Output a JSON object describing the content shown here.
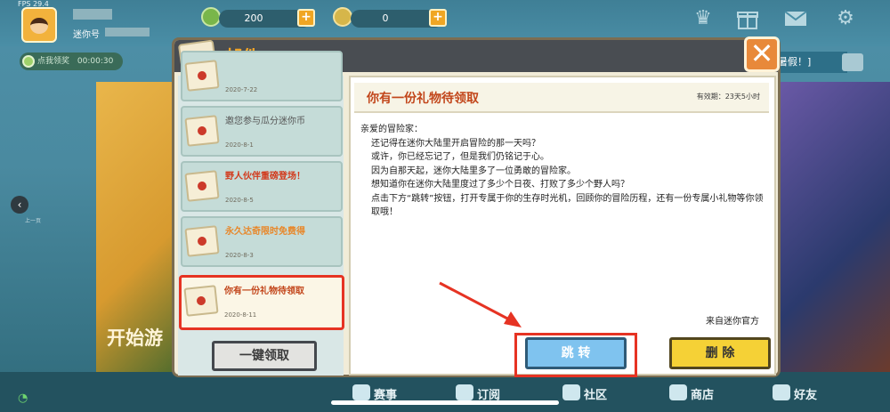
{
  "status": {
    "fps": "FPS 29.4"
  },
  "player": {
    "name": "迷你号"
  },
  "currencies": [
    {
      "icon": "mini-bean-icon",
      "value": "200"
    },
    {
      "icon": "mini-coin-icon",
      "value": "0"
    }
  ],
  "top_bar": {
    "icons": [
      "crown-icon",
      "gift-icon",
      "mail-icon",
      "gear-icon"
    ]
  },
  "claim_timer": {
    "label": "点我领奖",
    "time": "00:00:30"
  },
  "scene": {
    "prev_label": "上一页",
    "start_text": "开始游",
    "banner_text": "暑假！]"
  },
  "bottom_nav": [
    {
      "label": "赛事",
      "icon": "trophy-icon"
    },
    {
      "label": "订阅",
      "icon": "subscribe-icon"
    },
    {
      "label": "社区",
      "icon": "community-icon"
    },
    {
      "label": "商店",
      "icon": "cart-icon"
    },
    {
      "label": "好友",
      "icon": "friends-icon"
    }
  ],
  "mail_dialog": {
    "title": "邮件",
    "close_symbol": "✕",
    "items": [
      {
        "subject": "",
        "date": "2020-7-22",
        "color": "#3b3b3b"
      },
      {
        "subject": "邀您参与瓜分迷你币",
        "date": "2020-8-1",
        "color": "#555555"
      },
      {
        "subject": "野人伙伴重磅登场！",
        "date": "2020-8-5",
        "color": "#d23a1c"
      },
      {
        "subject": "永久达奇限时免费得",
        "date": "2020-8-3",
        "color": "#e8872a"
      },
      {
        "subject": "你有一份礼物待领取",
        "date": "2020-8-11",
        "color": "#c2461b",
        "selected": true
      }
    ],
    "claim_all_label": "一键领取",
    "selected": {
      "title": "你有一份礼物待领取",
      "expiry": "有效期：23天5小时",
      "greeting": "亲爱的冒险家：",
      "paragraphs": [
        "还记得在迷你大陆里开启冒险的那一天吗？",
        "或许，你已经忘记了，但是我们仍铭记于心。",
        "因为自那天起，迷你大陆里多了一位勇敢的冒险家。",
        "想知道你在迷你大陆里度过了多少个日夜、打败了多少个野人吗？",
        "点击下方“跳转”按钮，打开专属于你的生存时光机，回顾你的冒险历程，还有一份专属小礼物等你领取哦！"
      ],
      "sender": "来自迷你官方"
    },
    "jump_label": "跳 转",
    "delete_label": "删 除"
  },
  "annotation": {
    "highlight_color": "#e63323"
  }
}
